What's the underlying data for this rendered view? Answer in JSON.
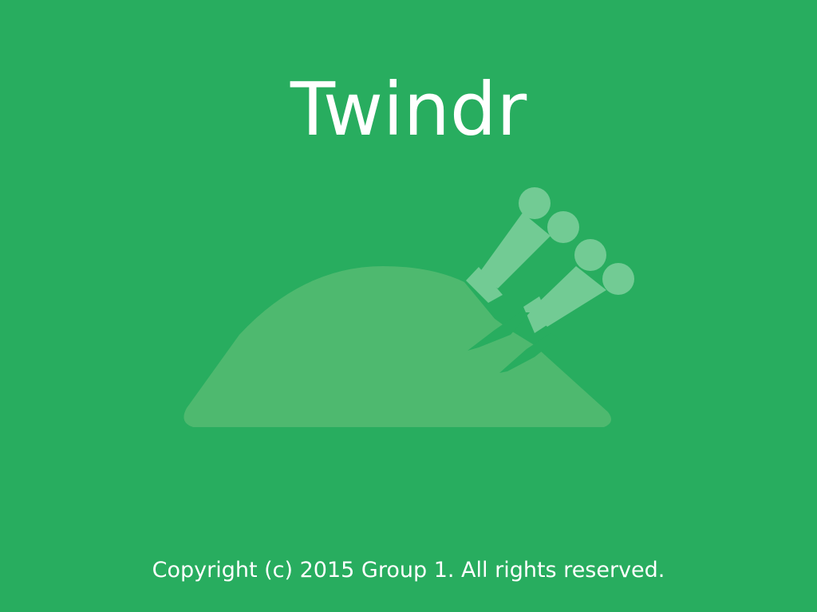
{
  "splash": {
    "title": "Twindr",
    "copyright": "Copyright (c) 2015 Group 1. All rights reserved.",
    "logo_icon": "roast-chicken-icon"
  },
  "colors": {
    "background": "#28ad5f",
    "logo_body": "#4eb96f",
    "logo_bones": "#72cb94",
    "text": "#ffffff"
  }
}
